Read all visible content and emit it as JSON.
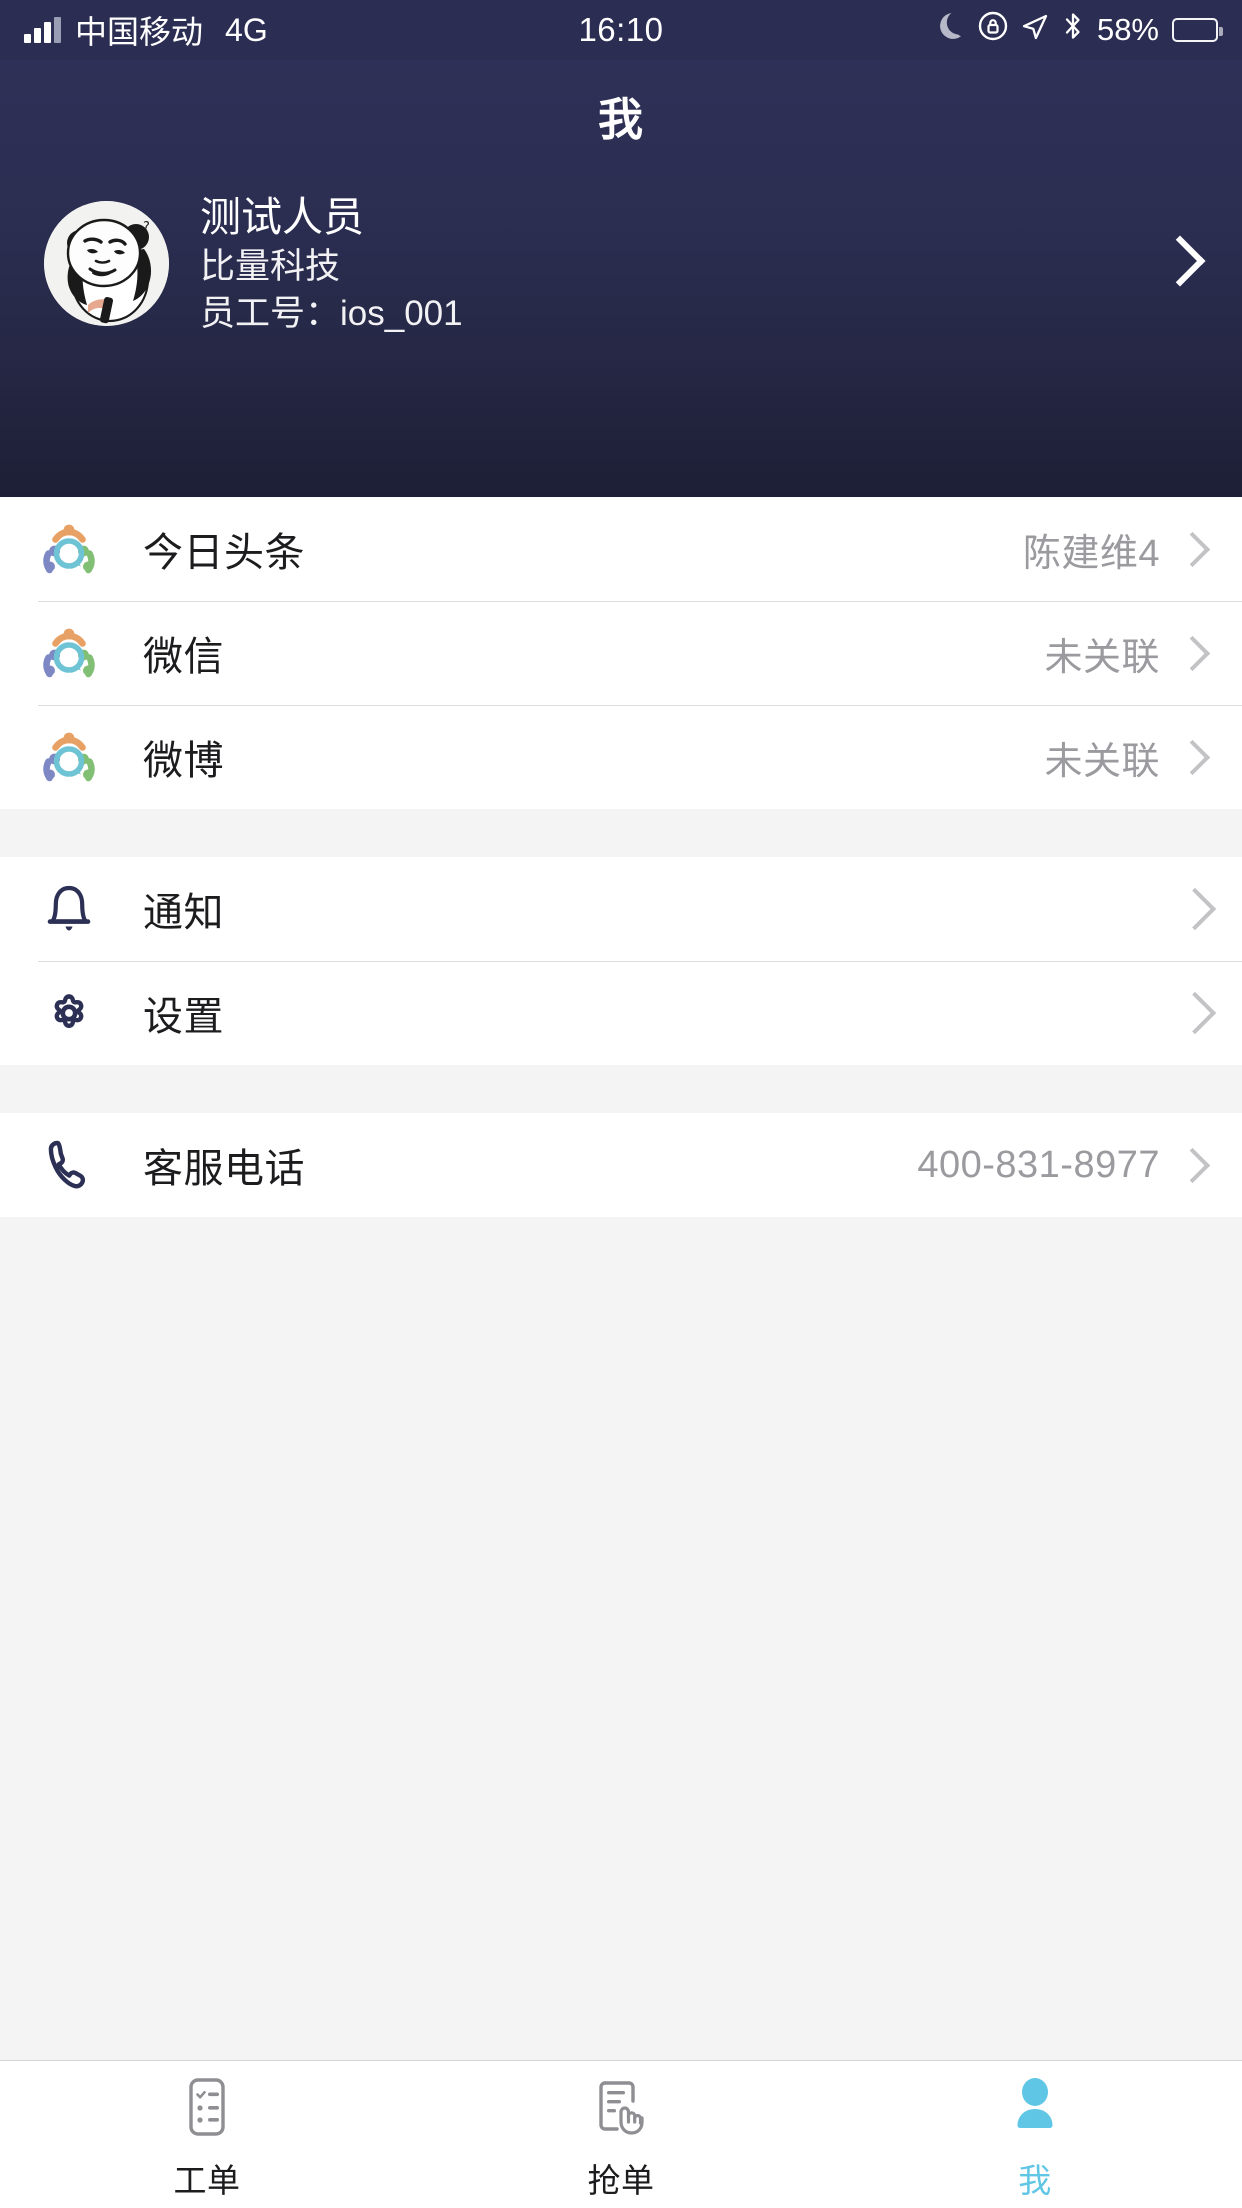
{
  "status_bar": {
    "carrier": "中国移动",
    "network": "4G",
    "time": "16:10",
    "battery_percent": "58%",
    "icons": [
      "signal-bars-icon",
      "moon-icon",
      "rotation-lock-icon",
      "location-arrow-icon",
      "bluetooth-icon",
      "battery-icon"
    ]
  },
  "header": {
    "title": "我",
    "profile": {
      "name": "测试人员",
      "company": "比量科技",
      "employee_id": "员工号：ios_001",
      "avatar_name": "panda-meme-avatar"
    }
  },
  "sections": [
    {
      "rows": [
        {
          "icon": "group-people-icon",
          "label": "今日头条",
          "value": "陈建维4"
        },
        {
          "icon": "group-people-icon",
          "label": "微信",
          "value": "未关联"
        },
        {
          "icon": "group-people-icon",
          "label": "微博",
          "value": "未关联"
        }
      ]
    },
    {
      "rows": [
        {
          "icon": "bell-icon",
          "label": "通知",
          "value": ""
        },
        {
          "icon": "gear-icon",
          "label": "设置",
          "value": ""
        }
      ]
    },
    {
      "rows": [
        {
          "icon": "phone-icon",
          "label": "客服电话",
          "value": "400-831-8977"
        }
      ]
    }
  ],
  "tabbar": {
    "active_index": 2,
    "tabs": [
      {
        "icon": "checklist-icon",
        "label": "工单"
      },
      {
        "icon": "tap-order-icon",
        "label": "抢单"
      },
      {
        "icon": "person-icon",
        "label": "我"
      }
    ]
  },
  "colors": {
    "header_top": "#2e3057",
    "header_bottom": "#1d1f36",
    "accent": "#5fc6e5",
    "page_background": "#f4f4f5",
    "card": "#ffffff",
    "value_text": "#9a9a9f",
    "icon_navy": "#2d3055"
  }
}
